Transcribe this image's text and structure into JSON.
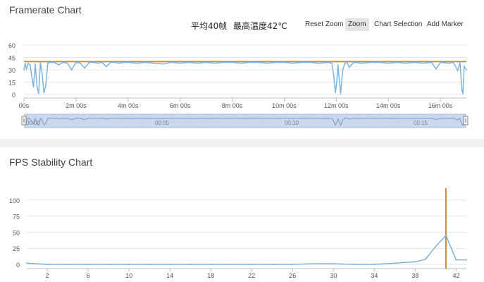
{
  "framerate_panel": {
    "title": "Framerate Chart",
    "avg_fps": "平均40帧",
    "max_temp": "最高温度42℃",
    "buttons": {
      "reset_zoom": "Reset Zoom",
      "zoom": "Zoom",
      "chart_selection": "Chart Selection",
      "add_marker": "Add Marker"
    },
    "navigator_labels": [
      "00:00",
      "00:05",
      "00:10",
      "00:15"
    ]
  },
  "stability_panel": {
    "title": "FPS Stability Chart"
  },
  "colors": {
    "series_line": "#7fb3dc",
    "reference_line": "#e08a1e",
    "navigator_fill": "#cad8ee",
    "grid": "#e6e6e6"
  },
  "chart_data": [
    {
      "type": "line",
      "title": "Framerate Chart",
      "x_unit": "seconds",
      "xlim": [
        0,
        1020
      ],
      "ylim": [
        0,
        60
      ],
      "yticks": [
        0,
        15,
        30,
        45,
        60
      ],
      "xticks": [
        {
          "v": 0,
          "label": "00s"
        },
        {
          "v": 120,
          "label": "2m 00s"
        },
        {
          "v": 240,
          "label": "4m 00s"
        },
        {
          "v": 360,
          "label": "6m 00s"
        },
        {
          "v": 480,
          "label": "8m 00s"
        },
        {
          "v": 600,
          "label": "10m 00s"
        },
        {
          "v": 720,
          "label": "12m 00s"
        },
        {
          "v": 840,
          "label": "14m 00s"
        },
        {
          "v": 960,
          "label": "16m 00s"
        }
      ],
      "reference_line": 40,
      "series": [
        {
          "x": [
            0,
            3,
            6,
            10,
            14,
            18,
            22,
            26,
            30,
            34,
            38,
            42,
            46,
            50,
            55,
            60,
            70,
            80,
            90,
            100,
            110,
            120,
            130,
            140,
            150,
            160,
            170,
            180,
            190,
            200,
            210,
            220,
            230,
            240,
            260,
            280,
            300,
            320,
            340,
            360,
            380,
            400,
            420,
            440,
            460,
            480,
            500,
            520,
            540,
            560,
            580,
            600,
            620,
            640,
            660,
            680,
            700,
            710,
            715,
            718,
            721,
            724,
            727,
            730,
            735,
            740,
            745,
            750,
            760,
            780,
            800,
            820,
            840,
            860,
            880,
            900,
            920,
            940,
            950,
            960,
            980,
            990,
            1000,
            1005,
            1010,
            1012,
            1015,
            1020
          ],
          "values": [
            30,
            38,
            31,
            38,
            36,
            22,
            9,
            37,
            10,
            1,
            39,
            25,
            2,
            10,
            38,
            39,
            39,
            36,
            39,
            38,
            30,
            39,
            38,
            32,
            39,
            39,
            38,
            39,
            34,
            39,
            39,
            38,
            39,
            39,
            38,
            39,
            38,
            37,
            39,
            38,
            39,
            38,
            39,
            38,
            39,
            39,
            38,
            39,
            39,
            38,
            39,
            39,
            38,
            39,
            39,
            38,
            39,
            38,
            20,
            2,
            15,
            36,
            18,
            1,
            30,
            38,
            39,
            33,
            39,
            38,
            39,
            39,
            38,
            39,
            38,
            39,
            38,
            39,
            31,
            39,
            38,
            39,
            29,
            39,
            5,
            1,
            34,
            30
          ]
        }
      ]
    },
    {
      "type": "line",
      "title": "FPS Stability Chart",
      "xlim": [
        0,
        43
      ],
      "ylim": [
        0,
        125
      ],
      "yticks": [
        0,
        25,
        50,
        75,
        100
      ],
      "xticks": [
        2,
        6,
        10,
        14,
        18,
        22,
        26,
        30,
        34,
        38,
        42
      ],
      "reference_line_x": 41,
      "series": [
        {
          "x": [
            0,
            2,
            4,
            6,
            8,
            10,
            12,
            14,
            16,
            18,
            20,
            22,
            24,
            26,
            28,
            30,
            32,
            34,
            35,
            36,
            37,
            38,
            39,
            40,
            41,
            42,
            43
          ],
          "values": [
            2,
            0,
            0,
            0,
            0,
            0,
            0,
            0,
            0,
            0,
            0,
            0,
            0,
            0,
            1,
            1,
            0,
            0,
            1,
            2,
            3,
            4,
            8,
            28,
            45,
            7,
            7
          ]
        }
      ]
    }
  ]
}
